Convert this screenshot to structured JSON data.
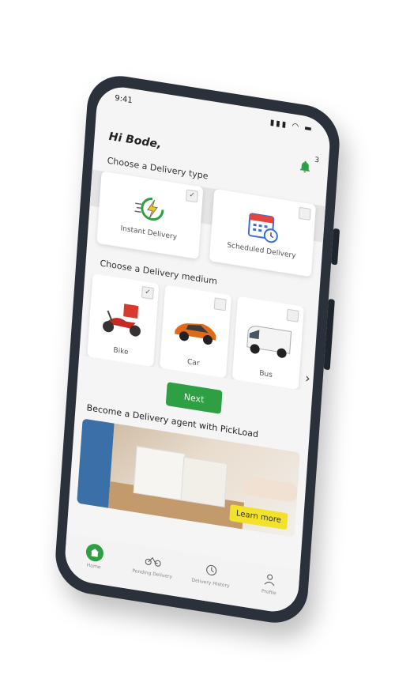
{
  "status_bar": {
    "time": "9:41",
    "icons": "▮▮▮ ◠ ▬"
  },
  "header": {
    "greeting": "Hi Bode,",
    "notification_count": "3"
  },
  "delivery_type": {
    "title": "Choose a Delivery type",
    "options": [
      {
        "label": "Instant Delivery",
        "checked": "✓"
      },
      {
        "label": "Scheduled Delivery",
        "checked": ""
      }
    ]
  },
  "delivery_medium": {
    "title": "Choose a Delivery medium",
    "options": [
      {
        "label": "Bike",
        "checked": "✓"
      },
      {
        "label": "Car",
        "checked": ""
      },
      {
        "label": "Bus",
        "checked": ""
      }
    ],
    "more": "›"
  },
  "next_label": "Next",
  "agent": {
    "title": "Become a Delivery agent with PickLoad",
    "cta": "Learn more"
  },
  "bottom_nav": [
    {
      "label": "Home",
      "icon": "home-icon"
    },
    {
      "label": "Pending Delivery",
      "icon": "bike-icon"
    },
    {
      "label": "Delivery History",
      "icon": "history-icon"
    },
    {
      "label": "Profile",
      "icon": "profile-icon"
    }
  ],
  "colors": {
    "accent": "#2ea043",
    "cta": "#f2e22b",
    "phone": "#2a313b"
  }
}
